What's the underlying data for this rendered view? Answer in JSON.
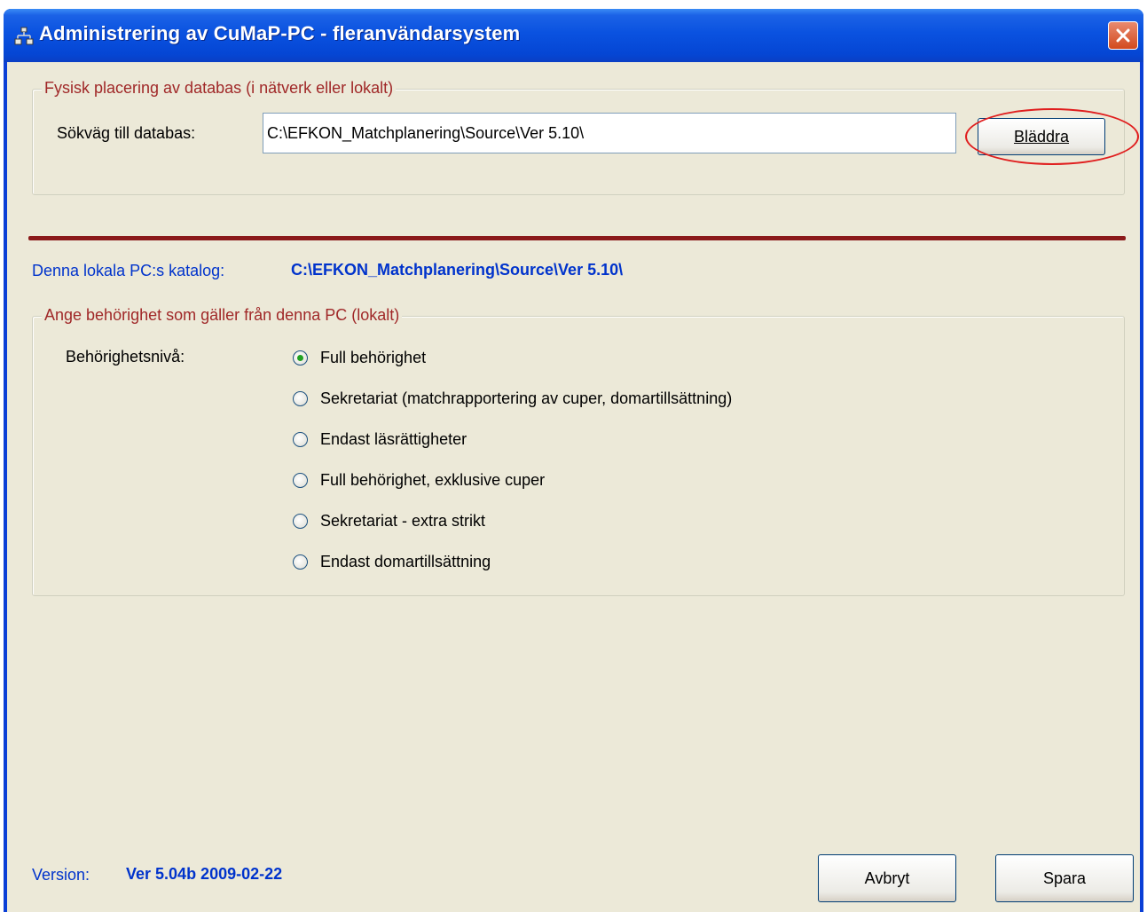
{
  "window": {
    "title": "Administrering av CuMaP-PC  - fleranvändarsystem",
    "icon": "network-icon"
  },
  "database_group": {
    "legend": "Fysisk placering av databas (i nätverk eller lokalt)",
    "path_label": "Sökväg till databas:",
    "path_value": "C:\\EFKON_Matchplanering\\Source\\Ver 5.10\\",
    "browse_button": "Bläddra"
  },
  "local": {
    "label": "Denna lokala PC:s katalog:",
    "value": "C:\\EFKON_Matchplanering\\Source\\Ver 5.10\\"
  },
  "permission_group": {
    "legend": "Ange behörighet som gäller från denna PC (lokalt)",
    "level_label": "Behörighetsnivå:",
    "options": [
      {
        "label": "Full behörighet",
        "checked": true
      },
      {
        "label": "Sekretariat (matchrapportering av cuper, domartillsättning)",
        "checked": false
      },
      {
        "label": "Endast läsrättigheter",
        "checked": false
      },
      {
        "label": "Full behörighet, exklusive cuper",
        "checked": false
      },
      {
        "label": "Sekretariat - extra strikt",
        "checked": false
      },
      {
        "label": "Endast domartillsättning",
        "checked": false
      }
    ]
  },
  "footer": {
    "version_label": "Version:",
    "version_value": "Ver 5.04b  2009-02-22",
    "cancel_button": "Avbryt",
    "save_button": "Spara"
  },
  "colors": {
    "titlebar": "#0a52e0",
    "client_background": "#ece9d8",
    "legend_text": "#a02828",
    "separator": "#8b1a1a",
    "highlight_oval": "#e01e1e",
    "blue_text": "#0033cc"
  }
}
